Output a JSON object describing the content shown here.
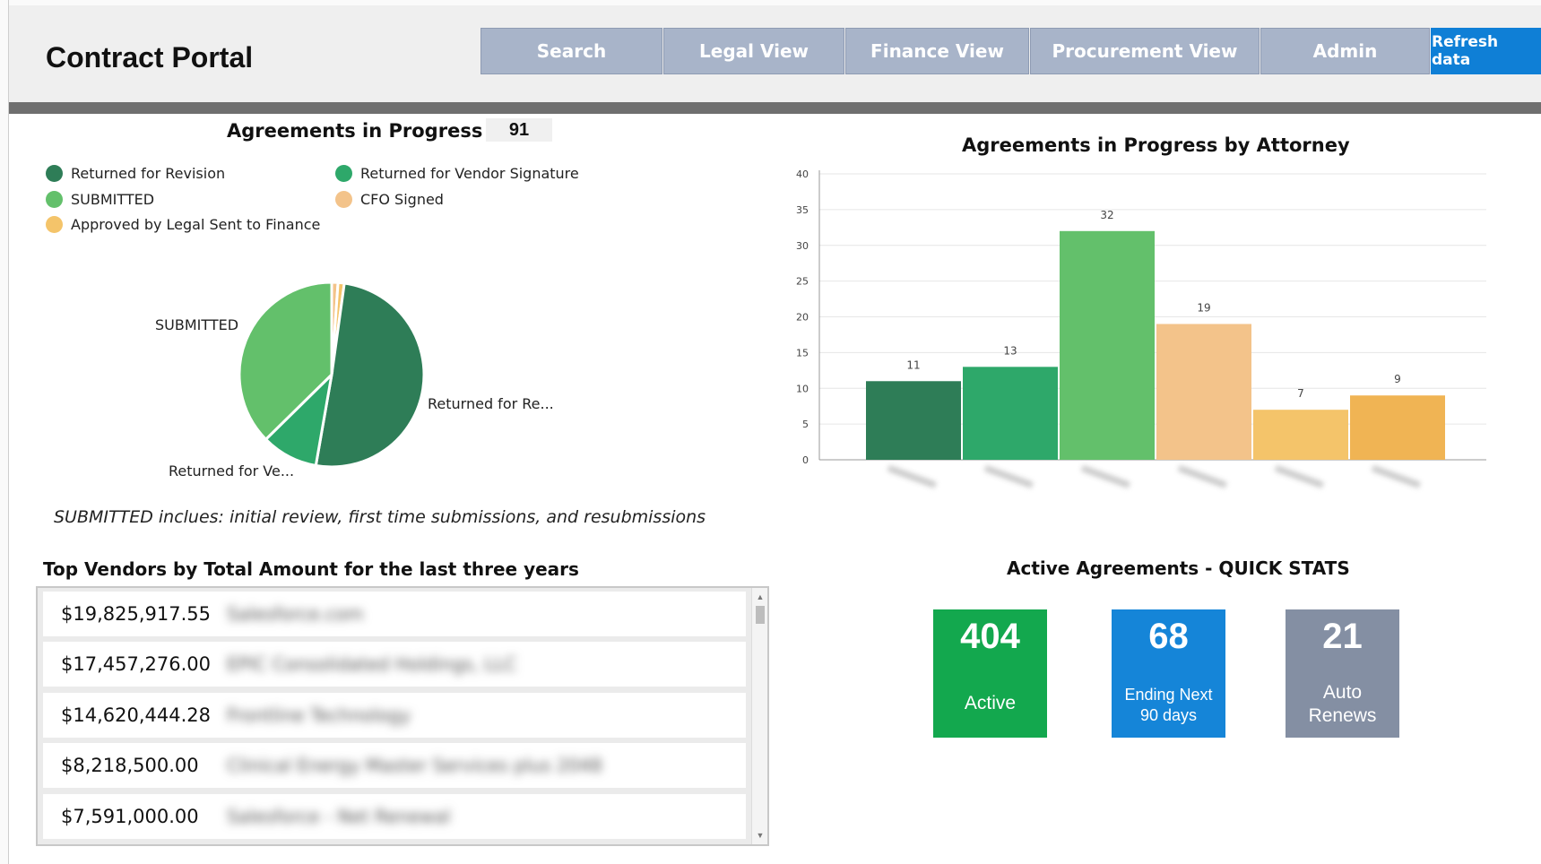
{
  "app": {
    "title": "Contract Portal"
  },
  "nav": [
    {
      "label": "Search"
    },
    {
      "label": "Legal View"
    },
    {
      "label": "Finance View"
    },
    {
      "label": "Procurement View"
    },
    {
      "label": "Admin"
    },
    {
      "label": "Refresh data"
    }
  ],
  "agreements_progress": {
    "title": "Agreements in Progress",
    "count": "91",
    "legend": [
      {
        "label": "Returned for Revision",
        "color": "#2e7d57"
      },
      {
        "label": "Returned for Vendor Signature",
        "color": "#2ea86a"
      },
      {
        "label": "SUBMITTED",
        "color": "#63c06b"
      },
      {
        "label": "CFO Signed",
        "color": "#f3c38a"
      },
      {
        "label": "Approved by Legal Sent to Finance",
        "color": "#f4c46a"
      }
    ],
    "pie_labels": {
      "submitted": "SUBMITTED",
      "returned_revision": "Returned for Re...",
      "returned_vendor": "Returned for Ve..."
    },
    "note": "SUBMITTED inclues: initial review, first time submissions, and resubmissions"
  },
  "chart_data": [
    {
      "type": "pie",
      "title": "",
      "labels": [
        "Returned for Revision",
        "Returned for Vendor Signature",
        "SUBMITTED",
        "CFO Signed",
        "Approved by Legal Sent to Finance"
      ],
      "values": [
        46,
        9,
        34,
        1,
        1
      ],
      "colors": [
        "#2e7d57",
        "#2ea86a",
        "#63c06b",
        "#f3c38a",
        "#f4c46a"
      ]
    },
    {
      "type": "bar",
      "title": "Agreements in Progress by Attorney",
      "categories": [
        "",
        "",
        "",
        "",
        "",
        ""
      ],
      "values": [
        11,
        13,
        32,
        19,
        7,
        9
      ],
      "colors": [
        "#2e7d57",
        "#2ea86a",
        "#63c06b",
        "#f3c38a",
        "#f4c46a",
        "#f0b454"
      ],
      "ylim": [
        0,
        40
      ],
      "yticks": [
        0,
        5,
        10,
        15,
        20,
        25,
        30,
        35,
        40
      ],
      "grid": true,
      "xlabel": "",
      "ylabel": ""
    }
  ],
  "vendors": {
    "title": "Top Vendors by Total Amount for the last three years",
    "rows": [
      {
        "amount": "$19,825,917.55",
        "name": "Salesforce.com"
      },
      {
        "amount": "$17,457,276.00",
        "name": "EPIC Consolidated Holdings, LLC"
      },
      {
        "amount": "$14,620,444.28",
        "name": "Frontline Technology"
      },
      {
        "amount": "$8,218,500.00",
        "name": "Clinical Energy Master Services plus 2048"
      },
      {
        "amount": "$7,591,000.00",
        "name": "Salesforce - Net Renewal"
      }
    ]
  },
  "quick_stats": {
    "title": "Active Agreements - QUICK STATS",
    "cards": [
      {
        "value": "404",
        "label": "Active",
        "color": "#13a84e"
      },
      {
        "value": "68",
        "label_line1": "Ending Next",
        "label_line2": "90 days",
        "color": "#1585d8"
      },
      {
        "value": "21",
        "label_line1": "Auto",
        "label_line2": "Renews",
        "color": "#848fa3"
      }
    ]
  }
}
